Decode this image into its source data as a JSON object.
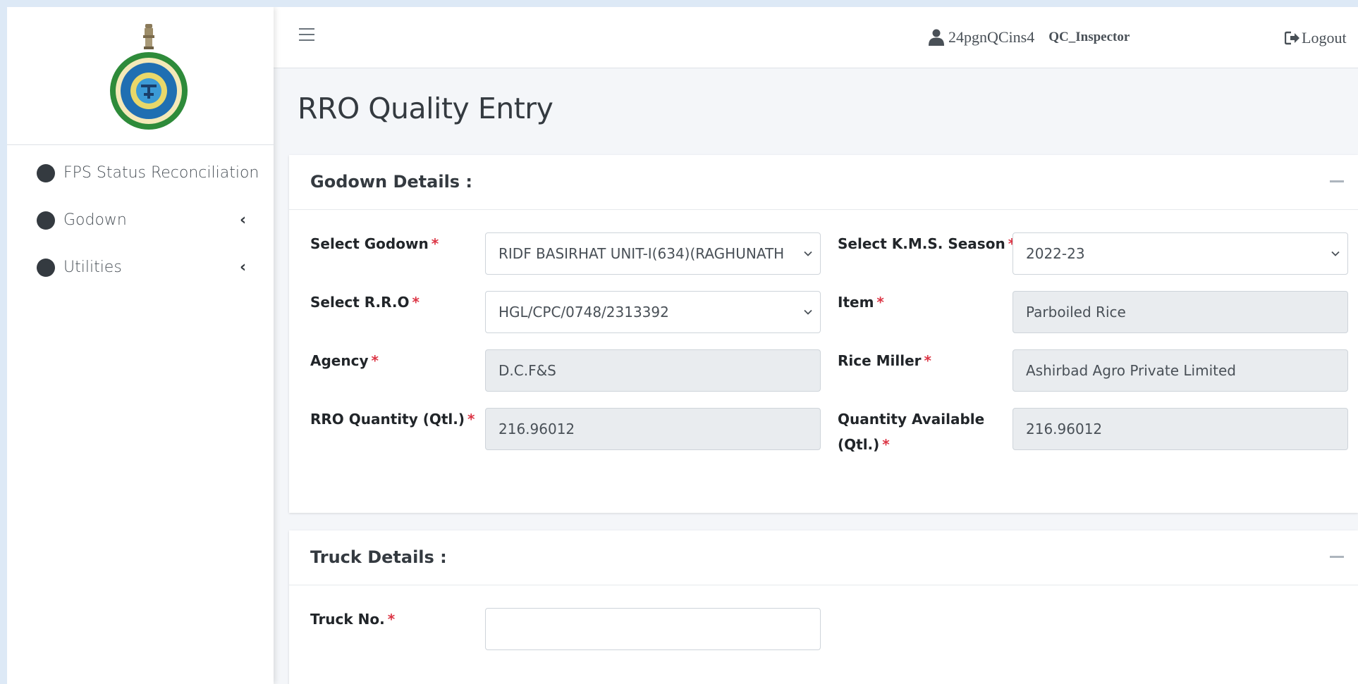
{
  "sidebar": {
    "items": [
      {
        "label": "FPS Status Reconciliation",
        "has_children": false
      },
      {
        "label": "Godown",
        "has_children": true
      },
      {
        "label": "Utilities",
        "has_children": true
      }
    ]
  },
  "header": {
    "username": "24pgnQCins4",
    "role": "QC_Inspector",
    "logout_label": "Logout"
  },
  "page": {
    "title": "RRO Quality Entry"
  },
  "godown_card": {
    "title": "Godown Details :",
    "fields": {
      "select_godown": {
        "label": "Select Godown",
        "value": "RIDF BASIRHAT UNIT-I(634)(RAGHUNATH"
      },
      "kms_season": {
        "label": "Select K.M.S. Season",
        "value": "2022-23"
      },
      "select_rro": {
        "label": "Select R.R.O",
        "value": "HGL/CPC/0748/2313392"
      },
      "item": {
        "label": "Item",
        "value": "Parboiled Rice"
      },
      "agency": {
        "label": "Agency",
        "value": "D.C.F&S"
      },
      "rice_miller": {
        "label": "Rice Miller",
        "value": "Ashirbad Agro Private Limited"
      },
      "rro_quantity": {
        "label": "RRO Quantity (Qtl.)",
        "value": "216.96012"
      },
      "qty_available": {
        "label_line1": "Quantity Available",
        "label_line2": "(Qtl.)",
        "value": "216.96012"
      }
    }
  },
  "truck_card": {
    "title": "Truck Details :",
    "fields": {
      "truck_no": {
        "label": "Truck No.",
        "value": ""
      }
    }
  },
  "required_marker": "*",
  "colors": {
    "required": "#dc3545",
    "sidebar_dot": "#343a40",
    "readonly_bg": "#e9ecef"
  }
}
